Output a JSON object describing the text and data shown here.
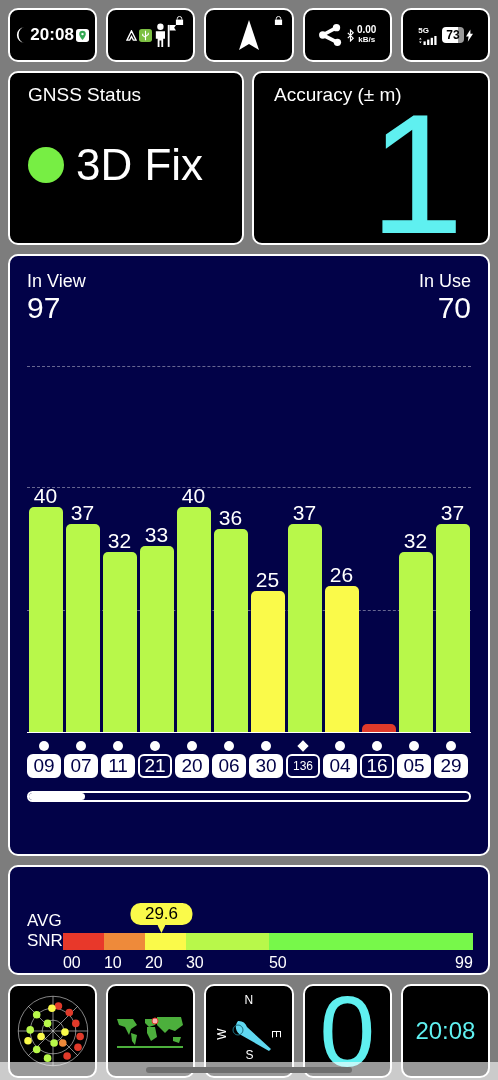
{
  "status_bar": {
    "time": "20:08",
    "net_speed": "0.00",
    "net_unit": "kB/s",
    "network": "5G",
    "battery": "73"
  },
  "gnss_status": {
    "title": "GNSS Status",
    "fix": "3D Fix",
    "color": "#77ee44"
  },
  "accuracy": {
    "title": "Accuracy (± m)",
    "value": "1"
  },
  "signal_panel": {
    "in_view_label": "In View",
    "in_view": "97",
    "in_use_label": "In Use",
    "in_use": "70",
    "satellites": [
      {
        "id": "09",
        "snr": "40",
        "level": 0.593,
        "color": "#b8f84a",
        "in_use": true,
        "kind": "dot"
      },
      {
        "id": "07",
        "snr": "37",
        "level": 0.548,
        "color": "#b8f84a",
        "in_use": true,
        "kind": "dot"
      },
      {
        "id": "11",
        "snr": "32",
        "level": 0.474,
        "color": "#b8f84a",
        "in_use": true,
        "kind": "dot"
      },
      {
        "id": "21",
        "snr": "33",
        "level": 0.489,
        "color": "#b8f84a",
        "in_use": false,
        "kind": "dot"
      },
      {
        "id": "20",
        "snr": "40",
        "level": 0.593,
        "color": "#b8f84a",
        "in_use": true,
        "kind": "dot"
      },
      {
        "id": "06",
        "snr": "36",
        "level": 0.533,
        "color": "#b8f84a",
        "in_use": true,
        "kind": "dot"
      },
      {
        "id": "30",
        "snr": "25",
        "level": 0.37,
        "color": "#fafa4a",
        "in_use": true,
        "kind": "dot"
      },
      {
        "id": "136",
        "snr": "37",
        "level": 0.548,
        "color": "#b8f84a",
        "in_use": false,
        "kind": "diamond"
      },
      {
        "id": "04",
        "snr": "26",
        "level": 0.385,
        "color": "#fafa4a",
        "in_use": true,
        "kind": "dot"
      },
      {
        "id": "16",
        "level": 0.02,
        "color": "#e03a2a",
        "in_use": false,
        "kind": "dot"
      },
      {
        "id": "05",
        "snr": "32",
        "level": 0.474,
        "color": "#b8f84a",
        "in_use": true,
        "kind": "dot"
      },
      {
        "id": "29",
        "snr": "37",
        "level": 0.548,
        "color": "#b8f84a",
        "in_use": true,
        "kind": "dot"
      }
    ]
  },
  "snr_panel": {
    "label_top": "AVG",
    "label_bottom": "SNR",
    "average": "29.6",
    "segments": [
      {
        "tick": "00",
        "color": "#e8382a"
      },
      {
        "tick": "10",
        "color": "#ee8a3a"
      },
      {
        "tick": "20",
        "color": "#fafa4a"
      },
      {
        "tick": "30",
        "color": "#b8f84a"
      },
      {
        "tick": "50",
        "color": "#77f84a"
      }
    ],
    "end_tick": "99"
  },
  "bottom_tiles": {
    "compass": {
      "north": "N",
      "east": "E",
      "south": "S",
      "west": "W"
    },
    "satellites_count": "0",
    "clock": "20:08"
  }
}
